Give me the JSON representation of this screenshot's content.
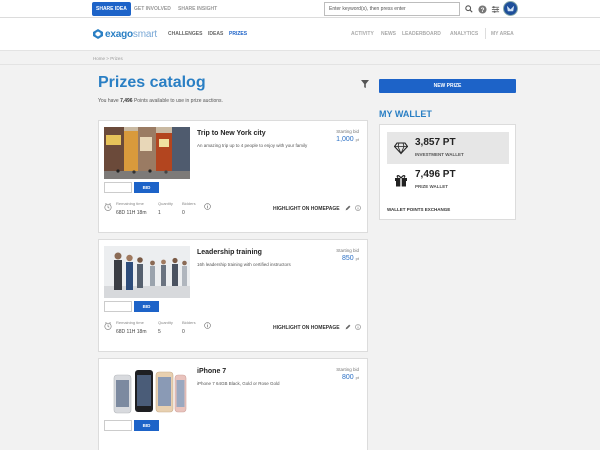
{
  "topbar": {
    "share_idea": "SHARE IDEA",
    "get_involved": "GET INVOLVED",
    "share_insight": "SHARE INSIGHT",
    "search_placeholder": "Enter keyword(s), then press enter"
  },
  "nav": {
    "logo": "exagosmart",
    "logo_a": "exago",
    "logo_b": "smart",
    "challenges": "CHALLENGES",
    "ideas": "IDEAS",
    "prizes": "PRIZES",
    "activity": "ACTIVITY",
    "news": "NEWS",
    "leaderboard": "LEADERBOARD",
    "analytics": "ANALYTICS",
    "my_area": "MY AREA"
  },
  "breadcrumb": {
    "home": "Home",
    "sep": ">",
    "current": "Prizes"
  },
  "page": {
    "title": "Prizes catalog",
    "points_prefix": "You have ",
    "points_value": "7,496",
    "points_suffix": " Points available to use in prize auctions."
  },
  "sidebar": {
    "new_prize": "NEW PRIZE",
    "wallet_title": "MY WALLET",
    "investment_value": "3,857 PT",
    "investment_label": "INVESTMENT WALLET",
    "prize_value": "7,496 PT",
    "prize_label": "PRIZE WALLET",
    "exchange": "WALLET POINTS EXCHANGE"
  },
  "labels": {
    "starting_bid": "Starting bid",
    "pt": "pt",
    "bid": "BID",
    "remaining_time": "Remaining time",
    "quantity": "Quantity",
    "bidders": "Bidders",
    "highlight": "HIGHLIGHT ON HOMEPAGE"
  },
  "prizes": [
    {
      "name": "Trip to New York city",
      "description": "An amazing trip up to 4 people to enjoy with your family",
      "starting_bid": "1,000",
      "remaining": "68D 11H 18m",
      "quantity": "1",
      "bidders": "0"
    },
    {
      "name": "Leadership training",
      "description": "16h leadership training with certified instructors",
      "starting_bid": "850",
      "remaining": "68D 11H 18m",
      "quantity": "5",
      "bidders": "0"
    },
    {
      "name": "iPhone 7",
      "description": "iPhone 7 64GB Black, Gold or Rose Gold",
      "starting_bid": "800"
    }
  ],
  "colors": {
    "accent": "#1d63c8",
    "title_blue": "#2a7fc4"
  },
  "icons": [
    "search-icon",
    "help-icon",
    "settings-icon",
    "filter-icon",
    "diamond-icon",
    "gift-icon",
    "clock-icon",
    "info-icon",
    "edit-icon"
  ]
}
